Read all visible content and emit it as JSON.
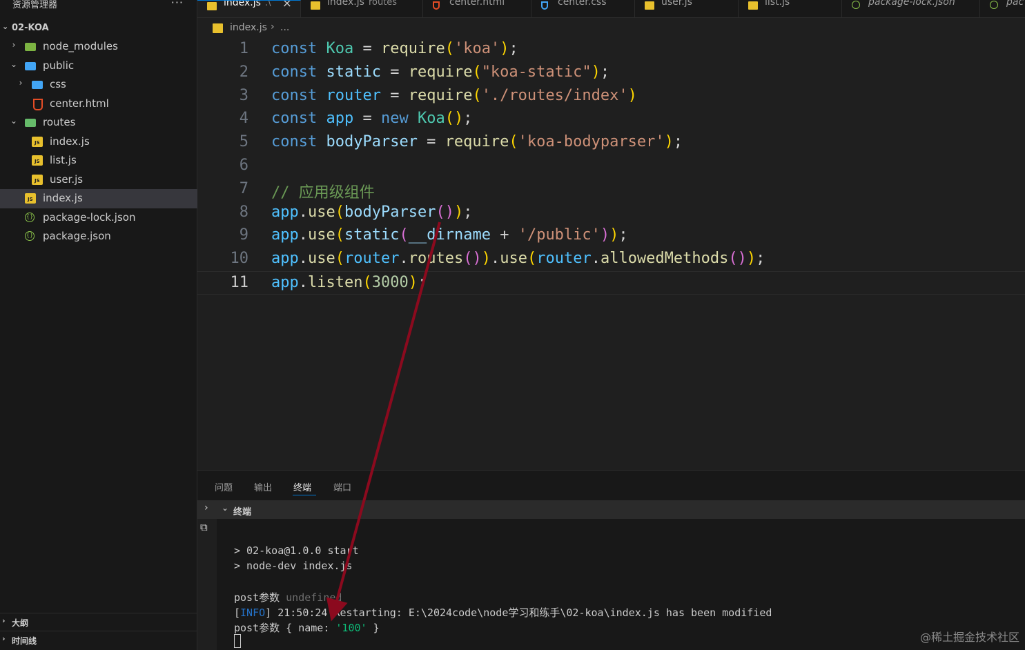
{
  "sidebar": {
    "title": "资源管理器",
    "more": "···",
    "root": "02-KOA",
    "tree": [
      {
        "label": "node_modules",
        "type": "folder",
        "icon": "folder-node-icon",
        "level": 0,
        "expanded": false
      },
      {
        "label": "public",
        "type": "folder",
        "icon": "folder-public-icon",
        "level": 0,
        "expanded": true
      },
      {
        "label": "css",
        "type": "folder",
        "icon": "folder-css-icon",
        "level": 1,
        "expanded": false
      },
      {
        "label": "center.html",
        "type": "file",
        "icon": "html-file-icon",
        "level": 1
      },
      {
        "label": "routes",
        "type": "folder",
        "icon": "folder-routes-icon",
        "level": 0,
        "expanded": true
      },
      {
        "label": "index.js",
        "type": "file",
        "icon": "js-file-icon",
        "level": 1
      },
      {
        "label": "list.js",
        "type": "file",
        "icon": "js-file-icon",
        "level": 1
      },
      {
        "label": "user.js",
        "type": "file",
        "icon": "js-file-icon",
        "level": 1
      },
      {
        "label": "index.js",
        "type": "file",
        "icon": "js-file-icon",
        "level": 0,
        "selected": true
      },
      {
        "label": "package-lock.json",
        "type": "file",
        "icon": "json-file-icon",
        "level": 0
      },
      {
        "label": "package.json",
        "type": "file",
        "icon": "json-file-icon",
        "level": 0
      }
    ],
    "outline": "大纲",
    "timeline": "时间线"
  },
  "tabs": [
    {
      "label": "index.js",
      "desc": ".\\",
      "icon": "js",
      "active": true,
      "close": "×"
    },
    {
      "label": "index.js",
      "desc": "routes",
      "icon": "js"
    },
    {
      "label": "center.html",
      "icon": "html"
    },
    {
      "label": "center.css",
      "icon": "css"
    },
    {
      "label": "user.js",
      "icon": "js"
    },
    {
      "label": "list.js",
      "icon": "js"
    },
    {
      "label": "package-lock.json",
      "icon": "json",
      "italic": true
    },
    {
      "label": "pac",
      "icon": "json",
      "italic": true
    }
  ],
  "breadcrumb": {
    "file": "index.js",
    "sep": "›",
    "more": "..."
  },
  "editor": {
    "current_line": 11,
    "lines": [
      {
        "num": "1",
        "tokens": [
          [
            "kw",
            "const"
          ],
          [
            "op",
            " "
          ],
          [
            "cls",
            "Koa"
          ],
          [
            "op",
            " = "
          ],
          [
            "fn",
            "require"
          ],
          [
            "b1",
            "("
          ],
          [
            "str",
            "'koa'"
          ],
          [
            "b1",
            ")"
          ],
          [
            "op",
            ";"
          ]
        ]
      },
      {
        "num": "2",
        "tokens": [
          [
            "kw",
            "const"
          ],
          [
            "op",
            " "
          ],
          [
            "var",
            "static"
          ],
          [
            "op",
            " = "
          ],
          [
            "fn",
            "require"
          ],
          [
            "b1",
            "("
          ],
          [
            "str",
            "\"koa-static\""
          ],
          [
            "b1",
            ")"
          ],
          [
            "op",
            ";"
          ]
        ]
      },
      {
        "num": "3",
        "tokens": [
          [
            "kw",
            "const"
          ],
          [
            "op",
            " "
          ],
          [
            "cvar",
            "router"
          ],
          [
            "op",
            " = "
          ],
          [
            "fn",
            "require"
          ],
          [
            "b1",
            "("
          ],
          [
            "str",
            "'./routes/index'"
          ],
          [
            "b1",
            ")"
          ]
        ]
      },
      {
        "num": "4",
        "tokens": [
          [
            "kw",
            "const"
          ],
          [
            "op",
            " "
          ],
          [
            "cvar",
            "app"
          ],
          [
            "op",
            " = "
          ],
          [
            "kw",
            "new"
          ],
          [
            "op",
            " "
          ],
          [
            "cls",
            "Koa"
          ],
          [
            "b1",
            "()"
          ],
          [
            "op",
            ";"
          ]
        ]
      },
      {
        "num": "5",
        "tokens": [
          [
            "kw",
            "const"
          ],
          [
            "op",
            " "
          ],
          [
            "var",
            "bodyParser"
          ],
          [
            "op",
            " = "
          ],
          [
            "fn",
            "require"
          ],
          [
            "b1",
            "("
          ],
          [
            "str",
            "'koa-bodyparser'"
          ],
          [
            "b1",
            ")"
          ],
          [
            "op",
            ";"
          ]
        ]
      },
      {
        "num": "6",
        "tokens": []
      },
      {
        "num": "7",
        "tokens": [
          [
            "cmt",
            "// 应用级组件"
          ]
        ]
      },
      {
        "num": "8",
        "tokens": [
          [
            "cvar",
            "app"
          ],
          [
            "op",
            "."
          ],
          [
            "fn",
            "use"
          ],
          [
            "b1",
            "("
          ],
          [
            "var",
            "bodyParser"
          ],
          [
            "b2",
            "()"
          ],
          [
            "b1",
            ")"
          ],
          [
            "op",
            ";"
          ]
        ]
      },
      {
        "num": "9",
        "tokens": [
          [
            "cvar",
            "app"
          ],
          [
            "op",
            "."
          ],
          [
            "fn",
            "use"
          ],
          [
            "b1",
            "("
          ],
          [
            "var",
            "static"
          ],
          [
            "b2",
            "("
          ],
          [
            "var",
            "__dirname"
          ],
          [
            "op",
            " + "
          ],
          [
            "str",
            "'/public'"
          ],
          [
            "b2",
            ")"
          ],
          [
            "b1",
            ")"
          ],
          [
            "op",
            ";"
          ]
        ]
      },
      {
        "num": "10",
        "tokens": [
          [
            "cvar",
            "app"
          ],
          [
            "op",
            "."
          ],
          [
            "fn",
            "use"
          ],
          [
            "b1",
            "("
          ],
          [
            "cvar",
            "router"
          ],
          [
            "op",
            "."
          ],
          [
            "fn",
            "routes"
          ],
          [
            "b2",
            "()"
          ],
          [
            "b1",
            ")"
          ],
          [
            "op",
            "."
          ],
          [
            "fn",
            "use"
          ],
          [
            "b1",
            "("
          ],
          [
            "cvar",
            "router"
          ],
          [
            "op",
            "."
          ],
          [
            "fn",
            "allowedMethods"
          ],
          [
            "b2",
            "()"
          ],
          [
            "b1",
            ")"
          ],
          [
            "op",
            ";"
          ]
        ]
      },
      {
        "num": "11",
        "tokens": [
          [
            "cvar",
            "app"
          ],
          [
            "op",
            "."
          ],
          [
            "fn",
            "listen"
          ],
          [
            "b1",
            "("
          ],
          [
            "num",
            "3000"
          ],
          [
            "b1",
            ")"
          ],
          [
            "op",
            ";"
          ]
        ]
      }
    ]
  },
  "panel": {
    "tabs": [
      "问题",
      "输出",
      "终端",
      "端口"
    ],
    "active_tab": "终端",
    "terminal_label": "终端",
    "terminal_lines": [
      {
        "segments": [
          [
            "plain",
            "> 02-koa@1.0.0 start"
          ]
        ]
      },
      {
        "segments": [
          [
            "plain",
            "> node-dev index.js"
          ]
        ]
      },
      {
        "segments": [
          [
            "plain",
            ""
          ]
        ]
      },
      {
        "segments": [
          [
            "plain",
            "post参数 "
          ],
          [
            "undef",
            "undefined"
          ]
        ]
      },
      {
        "segments": [
          [
            "plain",
            "["
          ],
          [
            "info",
            "INFO"
          ],
          [
            "plain",
            "] 21:50:24 Restarting: E:\\2024code\\node学习和练手\\02-koa\\index.js has been modified"
          ]
        ]
      },
      {
        "segments": [
          [
            "plain",
            "post参数 { name: "
          ],
          [
            "str",
            "'100'"
          ],
          [
            "plain",
            " }"
          ]
        ]
      }
    ]
  },
  "watermark": "@稀土掘金技术社区",
  "colors": {
    "annotation_arrow": "#8b0a1e",
    "accent": "#0078d4"
  }
}
